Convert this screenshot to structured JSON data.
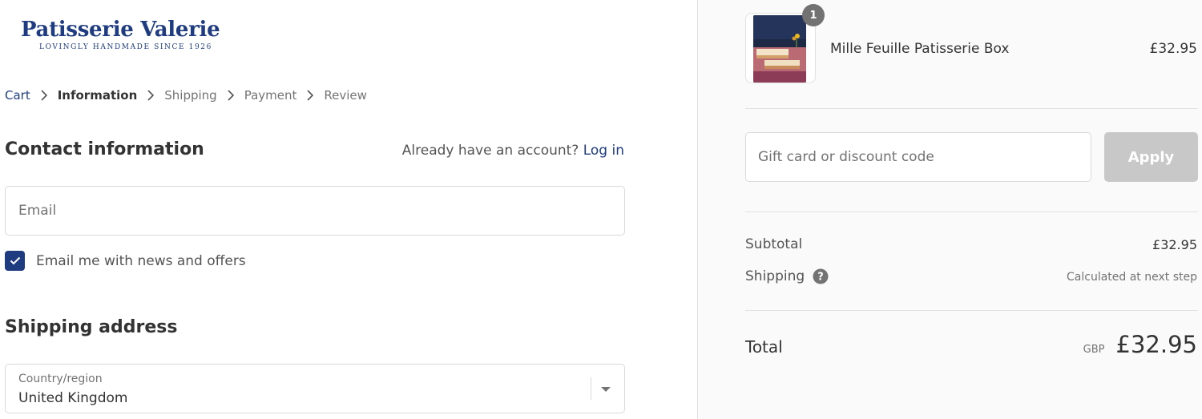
{
  "brand": {
    "name": "Patisserie Valerie",
    "tagline": "LOVINGLY HANDMADE SINCE 1926",
    "color": "#1f3c80"
  },
  "breadcrumb": [
    {
      "label": "Cart",
      "state": "link"
    },
    {
      "label": "Information",
      "state": "current"
    },
    {
      "label": "Shipping",
      "state": "upcoming"
    },
    {
      "label": "Payment",
      "state": "upcoming"
    },
    {
      "label": "Review",
      "state": "upcoming"
    }
  ],
  "contact": {
    "title": "Contact information",
    "account_prompt": "Already have an account?",
    "login_label": "Log in",
    "email_placeholder": "Email",
    "newsletter_label": "Email me with news and offers",
    "newsletter_checked": true
  },
  "shipping_address": {
    "title": "Shipping address",
    "country_label": "Country/region",
    "country_value": "United Kingdom"
  },
  "order": {
    "item": {
      "name": "Mille Feuille Patisserie Box",
      "price": "£32.95",
      "quantity": "1",
      "icon": "product-photo"
    },
    "discount_placeholder": "Gift card or discount code",
    "apply_label": "Apply",
    "subtotal_label": "Subtotal",
    "subtotal_value": "£32.95",
    "shipping_label": "Shipping",
    "shipping_value": "Calculated at next step",
    "total_label": "Total",
    "currency": "GBP",
    "total_value": "£32.95"
  },
  "colors": {
    "accent": "#1f3c80",
    "apply_disabled": "#c8c8c8",
    "sidebar_bg": "#fafafa"
  }
}
